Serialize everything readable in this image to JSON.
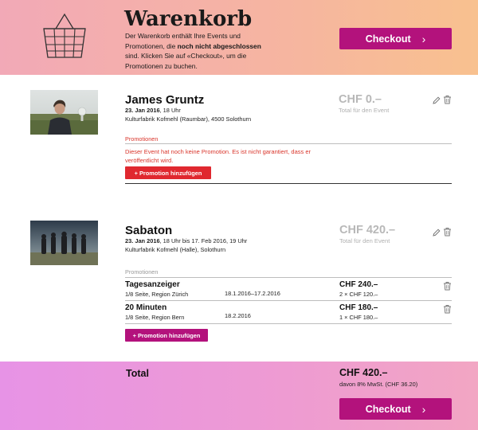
{
  "header": {
    "title": "Warenkorb",
    "text_part1": "Der Warenkorb enthält Ihre Events und Promotionen, die ",
    "text_bold": "noch nicht abgeschlossen",
    "text_part2": " sind. Klicken Sie auf «Checkout», um die Promotionen zu buchen.",
    "checkout_label": "Checkout",
    "basket_icon": "basket-icon"
  },
  "events": [
    {
      "name": "James Gruntz",
      "date": "23. Jan 2016",
      "time": ", 18 Uhr",
      "venue": "Kulturfabrik Kofmehl (Raumbar), 4500 Solothurn",
      "price": "CHF 0.–",
      "price_label": "Total für den Event",
      "section_label": "Promotionen",
      "warning": "Dieser Event hat noch keine Promotion. Es ist nicht garantiert, dass er veröffentlicht wird.",
      "add_promo_label": "+ Promotion hinzufügen",
      "accent": "#e0282f"
    },
    {
      "name": "Sabaton",
      "date": "23. Jan 2016",
      "time": ", 18 Uhr bis 17. Feb 2016, 19 Uhr",
      "venue": "Kulturfabrik Kofmehl (Halle), Solothurn",
      "price": "CHF 420.–",
      "price_label": "Total für den Event",
      "section_label": "Promotionen",
      "add_promo_label": "+ Promotion hinzufügen",
      "accent": "#b3127c",
      "promotions": [
        {
          "name": "Tagesanzeiger",
          "detail": "1/8 Seite, Region Zürich",
          "dates": "18.1.2016–17.2.2016",
          "price": "CHF 240.–",
          "qty": "2 × CHF 120.–"
        },
        {
          "name": "20 Minuten",
          "detail": "1/8 Seite, Region Bern",
          "dates": "18.2.2016",
          "price": "CHF 180.–",
          "qty": "1 × CHF 180.–"
        }
      ]
    }
  ],
  "footer": {
    "total_label": "Total",
    "total_price": "CHF 420.–",
    "vat": "davon 8% MwSt. (CHF 36.20)",
    "checkout_label": "Checkout"
  }
}
